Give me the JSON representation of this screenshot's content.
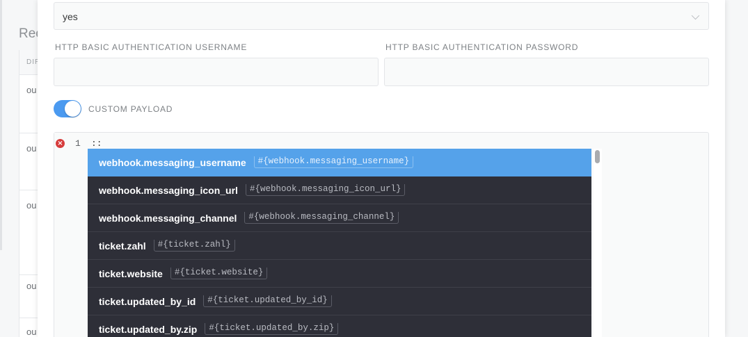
{
  "background": {
    "title": "Rec",
    "table_header": "DIR",
    "rows": [
      "ou",
      "ou",
      "ou",
      "ou",
      "ou"
    ]
  },
  "form": {
    "select_value": "yes",
    "username_label": "HTTP BASIC AUTHENTICATION USERNAME",
    "username_value": "",
    "password_label": "HTTP BASIC AUTHENTICATION PASSWORD",
    "password_value": "",
    "custom_payload_label": "CUSTOM PAYLOAD",
    "custom_payload_enabled": true
  },
  "editor": {
    "line_number": "1",
    "code": "::",
    "error_icon": "error-x-icon"
  },
  "autocomplete": {
    "items": [
      {
        "name": "webhook.messaging_username",
        "code": "#{webhook.messaging_username}",
        "active": true
      },
      {
        "name": "webhook.messaging_icon_url",
        "code": "#{webhook.messaging_icon_url}",
        "active": false
      },
      {
        "name": "webhook.messaging_channel",
        "code": "#{webhook.messaging_channel}",
        "active": false
      },
      {
        "name": "ticket.zahl",
        "code": "#{ticket.zahl}",
        "active": false
      },
      {
        "name": "ticket.website",
        "code": "#{ticket.website}",
        "active": false
      },
      {
        "name": "ticket.updated_by_id",
        "code": "#{ticket.updated_by_id}",
        "active": false
      },
      {
        "name": "ticket.updated_by.zip",
        "code": "#{ticket.updated_by.zip}",
        "active": false
      }
    ]
  },
  "colors": {
    "accent": "#4b9af0",
    "autocomplete_bg": "#2e2f38",
    "autocomplete_active": "#55a2ea",
    "error": "#d63c3c"
  }
}
